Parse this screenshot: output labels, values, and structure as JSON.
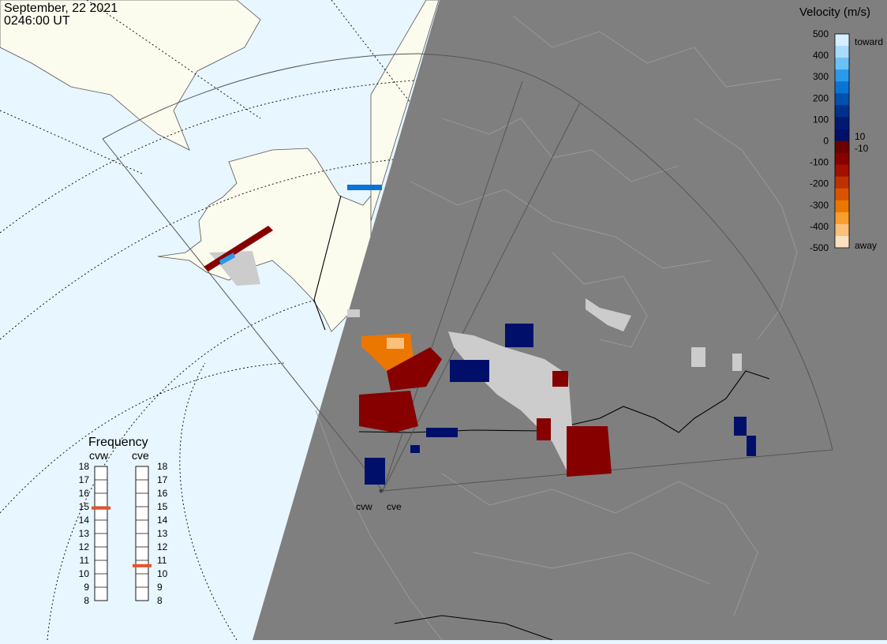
{
  "header": {
    "date": "September, 22 2021",
    "time": "0246:00 UT"
  },
  "colors": {
    "ocean": "#e8f6ff",
    "land": "#fbfbee",
    "night": "#7f7f7f",
    "ground_scatter": "#cccccc"
  },
  "velocity_scale": {
    "title": "Velocity (m/s)",
    "ticks": [
      "500",
      "400",
      "300",
      "200",
      "100",
      "0",
      "-100",
      "-200",
      "-300",
      "-400",
      "-500"
    ],
    "toward_label": "toward",
    "away_label": "away",
    "pos_threshold": "10",
    "neg_threshold": "-10",
    "colors_top_to_bottom": [
      "#d6efff",
      "#a8dcfa",
      "#6bc2f5",
      "#2a99ea",
      "#0b73d6",
      "#0050b0",
      "#00308d",
      "#001a72",
      "#00106a",
      "#6b0000",
      "#860000",
      "#a31000",
      "#bf3200",
      "#d85400",
      "#eb7600",
      "#f99d2c",
      "#fbc07a",
      "#fde0c0"
    ]
  },
  "frequency": {
    "title": "Frequency",
    "radars": [
      {
        "name": "cvw",
        "value_mhz": 14.9
      },
      {
        "name": "cve",
        "value_mhz": 10.6
      }
    ],
    "ticks": [
      "18",
      "17",
      "16",
      "15",
      "14",
      "13",
      "12",
      "11",
      "10",
      "9",
      "8"
    ],
    "marker_color": "#e8502a"
  },
  "radar_sites": [
    {
      "label": "cvw"
    },
    {
      "label": "cve"
    }
  ]
}
